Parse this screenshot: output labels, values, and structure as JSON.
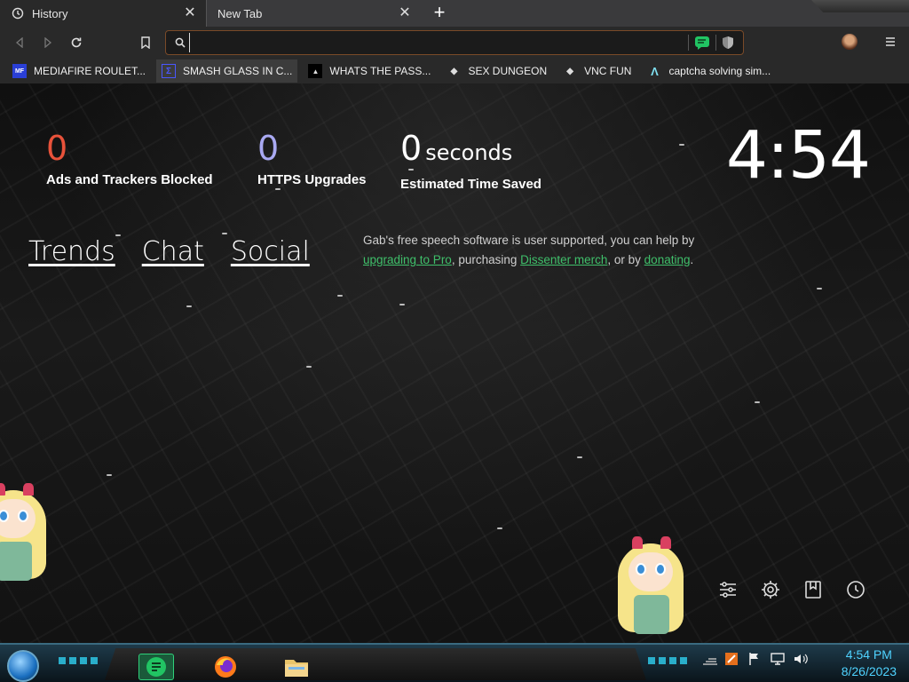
{
  "tabs": [
    {
      "title": "History",
      "icon": "history-icon",
      "active": true
    },
    {
      "title": "New Tab",
      "icon": "none",
      "active": false
    }
  ],
  "toolbar": {
    "url_value": "",
    "icons": [
      "back-icon",
      "forward-icon",
      "reload-icon",
      "bookmark-icon",
      "search-icon",
      "chat-icon",
      "shield-icon",
      "profile-avatar",
      "menu-icon"
    ]
  },
  "bookmarks": [
    {
      "label": "MEDIAFIRE ROULET...",
      "icon": "mediafire-icon",
      "icon_text": "MF"
    },
    {
      "label": "SMASH GLASS IN C...",
      "icon": "smash-icon",
      "icon_text": "Σ"
    },
    {
      "label": "WHATS THE PASS...",
      "icon": "terminal-icon",
      "icon_text": "▲"
    },
    {
      "label": "SEX DUNGEON",
      "icon": "cube-icon",
      "icon_text": "◆"
    },
    {
      "label": "VNC FUN",
      "icon": "cube-icon",
      "icon_text": "◆"
    },
    {
      "label": "captcha solving sim...",
      "icon": "captcha-icon",
      "icon_text": "Λ"
    }
  ],
  "stats": {
    "ads_blocked": {
      "value": "0",
      "label": "Ads and Trackers Blocked",
      "color": "#e8523a"
    },
    "https_upgrades": {
      "value": "0",
      "label": "HTTPS Upgrades",
      "color": "#a9a9f2"
    },
    "time_saved": {
      "value": "0",
      "unit": "seconds",
      "label": "Estimated Time Saved",
      "color": "#ffffff"
    }
  },
  "clock": "4:54",
  "links": {
    "trends": "Trends",
    "chat": "Chat",
    "social": "Social"
  },
  "gab_note": {
    "t1": "Gab's free speech software is user supported, you can help by ",
    "l1": "upgrading to Pro",
    "t2": ", purchasing ",
    "l2": "Dissenter merch",
    "t3": ", or by ",
    "l3": "donating",
    "t4": "."
  },
  "taskbar": {
    "time": "4:54 PM",
    "date": "8/26/2023",
    "apps": [
      "notes-app-icon",
      "firefox-icon",
      "file-explorer-icon"
    ],
    "tray_icons": [
      "network-bars-icon",
      "uac-icon",
      "flag-icon",
      "monitor-icon",
      "volume-icon"
    ]
  }
}
